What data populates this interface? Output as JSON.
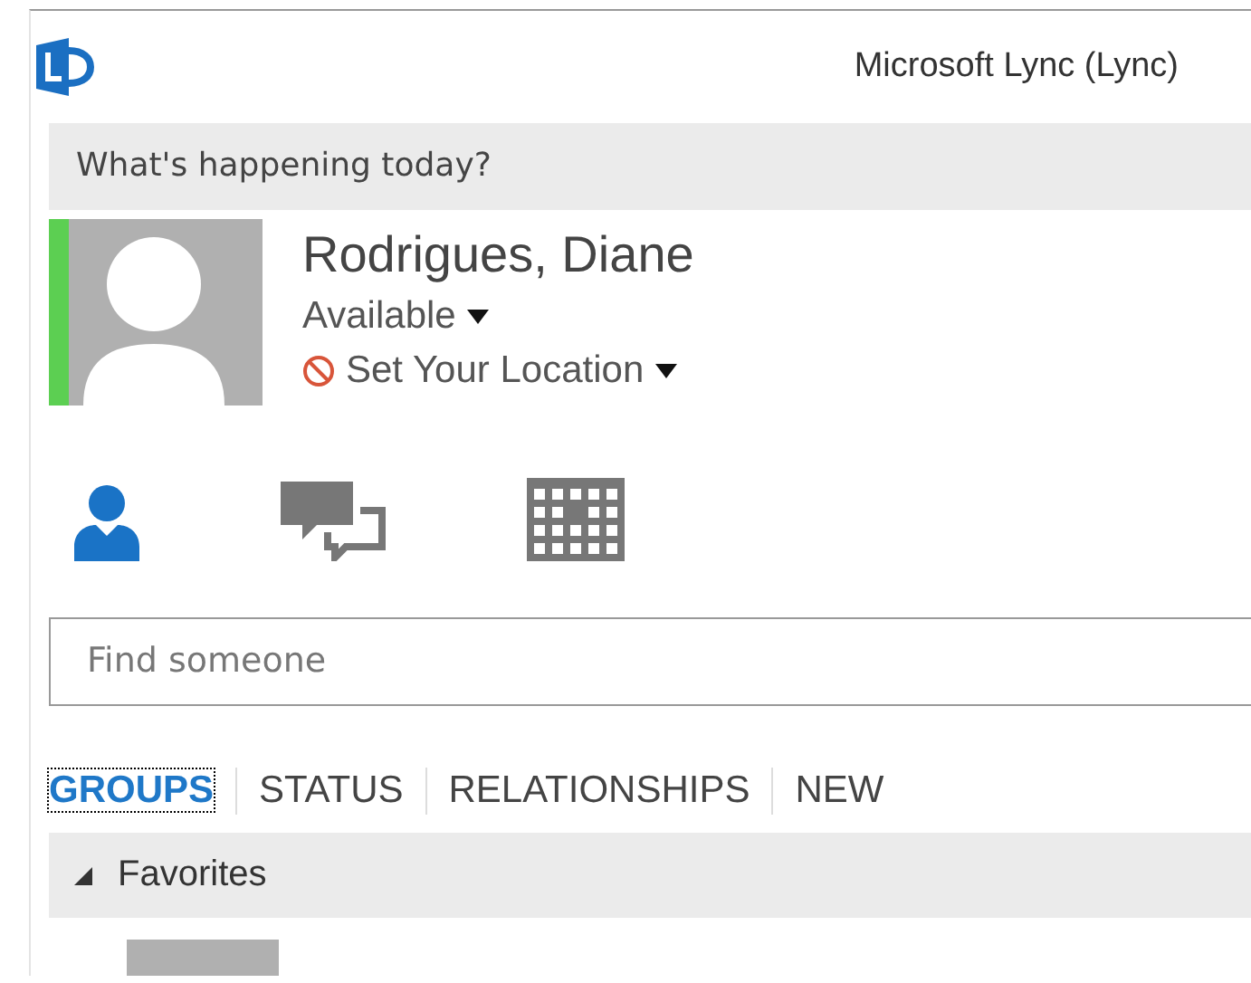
{
  "window": {
    "title": "Microsoft Lync  (Lync)"
  },
  "note": {
    "placeholder": "What's happening today?"
  },
  "profile": {
    "name": "Rodrigues, Diane",
    "presence": "Available",
    "color": "#5ccf52",
    "location": "Set Your Location"
  },
  "views": [
    {
      "kind": "contacts",
      "selected": true
    },
    {
      "kind": "conversations",
      "selected": false
    },
    {
      "kind": "meetings",
      "selected": false
    }
  ],
  "search": {
    "placeholder": "Find someone"
  },
  "tabs": [
    {
      "label": "GROUPS",
      "selected": true
    },
    {
      "label": "STATUS",
      "selected": false
    },
    {
      "label": "RELATIONSHIPS",
      "selected": false
    },
    {
      "label": "NEW",
      "selected": false
    }
  ],
  "groups": [
    {
      "name": "Favorites",
      "expanded": true
    }
  ]
}
